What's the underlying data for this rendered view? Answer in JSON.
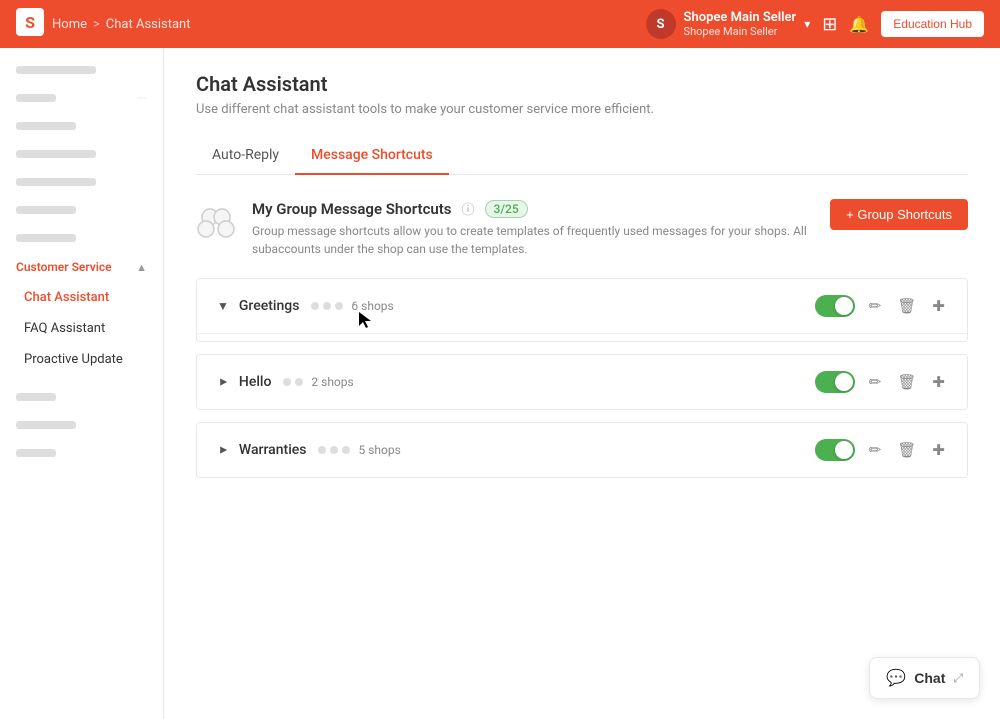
{
  "topnav": {
    "logo_letter": "S",
    "breadcrumb_home": "Home",
    "breadcrumb_sep": ">",
    "breadcrumb_current": "Chat Assistant",
    "seller_name": "Shopee Main Seller",
    "seller_sub": "Shopee Main Seller",
    "grid_icon": "⊞",
    "bell_icon": "🔔",
    "edu_btn_label": "Education Hub"
  },
  "sidebar": {
    "items": [
      {
        "label": "",
        "width": "long",
        "count": ""
      },
      {
        "label": "",
        "width": "short",
        "count": ""
      },
      {
        "label": "",
        "width": "medium",
        "count": ""
      },
      {
        "label": "",
        "width": "long",
        "count": ""
      },
      {
        "label": "",
        "width": "long",
        "count": ""
      },
      {
        "label": "",
        "width": "medium",
        "count": ""
      },
      {
        "label": "",
        "width": "medium",
        "count": ""
      }
    ],
    "customer_service_section": "Customer Service",
    "sub_items": [
      {
        "label": "Chat Assistant",
        "active": true
      },
      {
        "label": "FAQ Assistant",
        "active": false
      },
      {
        "label": "Proactive Update",
        "active": false
      }
    ]
  },
  "page": {
    "title": "Chat Assistant",
    "description": "Use different chat assistant tools to make your customer service more efficient."
  },
  "tabs": [
    {
      "label": "Auto-Reply",
      "active": false
    },
    {
      "label": "Message Shortcuts",
      "active": true
    }
  ],
  "section": {
    "title": "My Group Message Shortcuts",
    "badge": "3/25",
    "description": "Group message shortcuts allow you to create templates of frequently used messages for your shops. All subaccounts under the shop can use the templates.",
    "add_btn": "+ Group Shortcuts"
  },
  "shortcut_groups": [
    {
      "name": "Greetings",
      "dots": 3,
      "shops_count": "6 shops",
      "enabled": true
    },
    {
      "name": "Hello",
      "dots": 2,
      "shops_count": "2 shops",
      "enabled": true
    },
    {
      "name": "Warranties",
      "dots": 3,
      "shops_count": "5 shops",
      "enabled": true
    }
  ],
  "chat_button": {
    "label": "Chat",
    "expand_icon": "⤢"
  }
}
